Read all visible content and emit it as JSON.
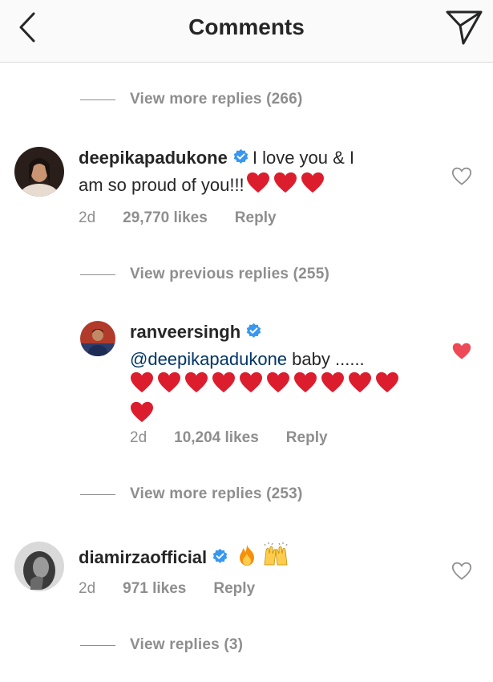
{
  "header": {
    "title": "Comments"
  },
  "threads": [
    {
      "toggle": "View more replies (266)"
    },
    {
      "username": "deepikapadukone",
      "text_line1": "I love you & I",
      "text_line2": "am so proud of you!!!",
      "time": "2d",
      "likes": "29,770 likes",
      "reply": "Reply"
    },
    {
      "toggle": "View previous replies (255)"
    },
    {
      "username": "ranveersingh",
      "mention": "@deepikapadukone",
      "text": "baby ......",
      "heart_count": 11,
      "time": "2d",
      "likes": "10,204 likes",
      "reply": "Reply"
    },
    {
      "toggle": "View more replies (253)"
    },
    {
      "username": "diamirzaofficial",
      "emojis": [
        "fire",
        "raising-hands"
      ],
      "time": "2d",
      "likes": "971 likes",
      "reply": "Reply"
    },
    {
      "toggle": "View replies (3)"
    }
  ],
  "colors": {
    "heart_red": "#ed4956",
    "verified_blue": "#3897f0",
    "secondary_text": "#8e8e8e",
    "mention_blue": "#003569"
  },
  "icons": [
    "back-chevron-icon",
    "send-direct-icon",
    "verified-badge-icon",
    "heart-outline-icon",
    "heart-filled-icon",
    "red-heart-emoji",
    "fire-emoji",
    "raising-hands-emoji"
  ]
}
